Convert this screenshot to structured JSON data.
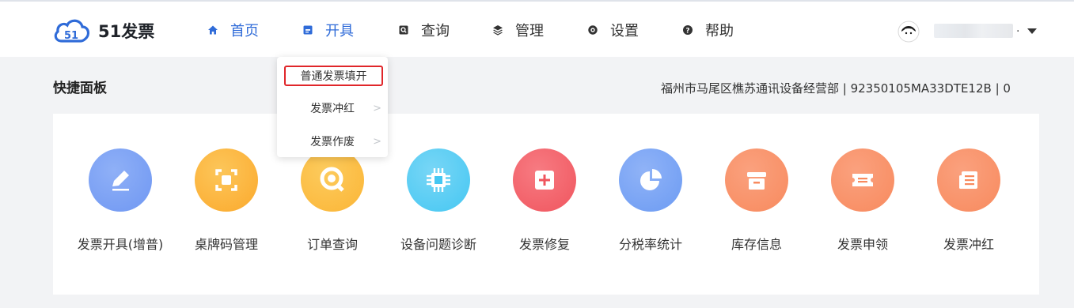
{
  "header": {
    "logo_text": "51发票",
    "nav": [
      {
        "label": "首页",
        "icon": "home-icon",
        "active": true
      },
      {
        "label": "开具",
        "icon": "invoice-icon",
        "active": true
      },
      {
        "label": "查询",
        "icon": "search-icon",
        "active": false
      },
      {
        "label": "管理",
        "icon": "layers-icon",
        "active": false
      },
      {
        "label": "设置",
        "icon": "gear-icon",
        "active": false
      },
      {
        "label": "帮助",
        "icon": "help-icon",
        "active": false
      }
    ],
    "user_suffix": "."
  },
  "dropdown": {
    "items": [
      {
        "label": "普通发票填开"
      },
      {
        "label": "发票冲红"
      },
      {
        "label": "发票作废"
      }
    ]
  },
  "panel": {
    "title": "快捷面板",
    "company": "福州市马尾区樵苏通讯设备经营部 | 92350105MA33DTE12B | 0"
  },
  "tiles": [
    {
      "label": "发票开具(增普)",
      "icon": "pen-icon",
      "color": "#6f97f2"
    },
    {
      "label": "桌牌码管理",
      "icon": "scan-icon",
      "color": "#fba92c"
    },
    {
      "label": "订单查询",
      "icon": "magnifier-icon",
      "color": "#fbb536"
    },
    {
      "label": "设备问题诊断",
      "icon": "chip-icon",
      "color": "#45c7f2"
    },
    {
      "label": "发票修复",
      "icon": "plus-square-icon",
      "color": "#f0555e"
    },
    {
      "label": "分税率统计",
      "icon": "pie-chart-icon",
      "color": "#6c9bf3"
    },
    {
      "label": "库存信息",
      "icon": "box-icon",
      "color": "#f88a5e"
    },
    {
      "label": "发票申领",
      "icon": "ticket-icon",
      "color": "#f88a5e"
    },
    {
      "label": "发票冲红",
      "icon": "document-icon",
      "color": "#f88a5e"
    }
  ]
}
